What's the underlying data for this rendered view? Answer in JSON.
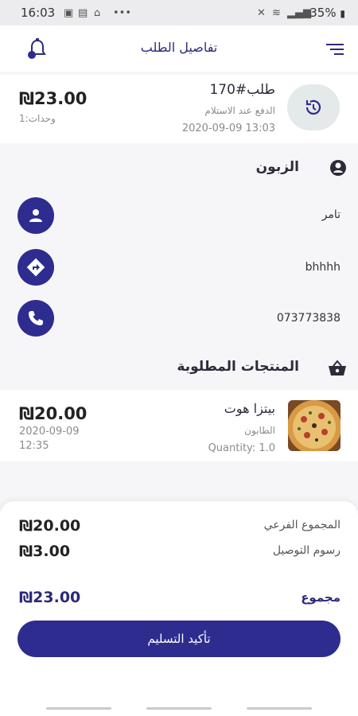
{
  "status_bar": {
    "time": "16:03",
    "battery": "35%"
  },
  "header": {
    "title": "تفاصيل الطلب"
  },
  "order": {
    "number": "طلب#170",
    "payment_method": "الدفع عند الاستلام",
    "date": "2020-09-09 13:03",
    "total": "₪23.00",
    "units": "وحدات:1"
  },
  "customer": {
    "section_title": "الزبون",
    "name": "تامر",
    "address": "bhhhh",
    "phone": "073773838"
  },
  "products": {
    "section_title": "المنتجات المطلوبة",
    "items": [
      {
        "name": "بيتزا هوت",
        "category": "الطابون",
        "quantity": "Quantity: 1.0",
        "price": "₪20.00",
        "date": "2020-09-09",
        "time": "12:35"
      }
    ]
  },
  "totals": {
    "subtotal_label": "المجموع الفرعي",
    "subtotal": "₪20.00",
    "delivery_label": "رسوم التوصيل",
    "delivery": "₪3.00",
    "total_label": "مجموع",
    "total": "₪23.00",
    "confirm_label": "تأكيد التسليم"
  },
  "colors": {
    "accent": "#2e2c8f",
    "title": "#2c2a78",
    "muted": "#8a8a92"
  }
}
